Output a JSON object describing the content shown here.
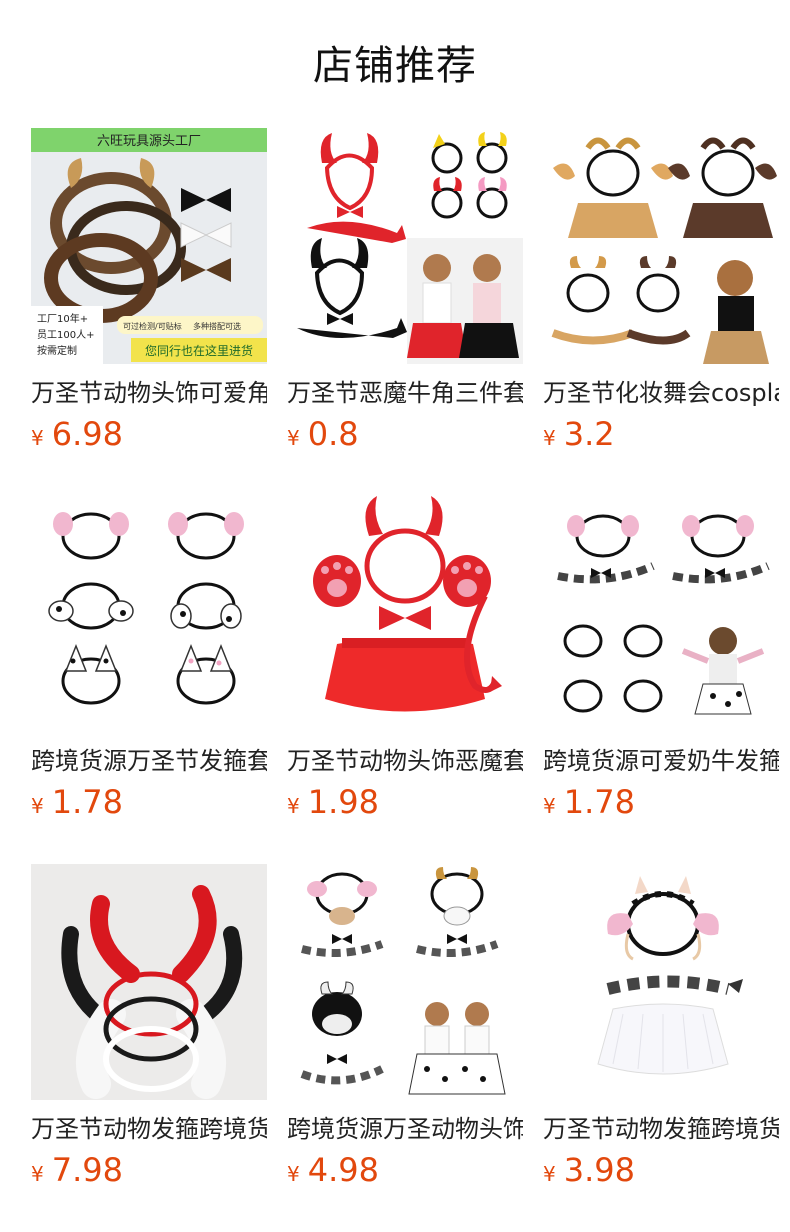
{
  "header": {
    "title": "店铺推荐"
  },
  "products": [
    {
      "name": "万圣节动物头饰可爱角",
      "currency": "¥",
      "price": "6.98",
      "thumb_text": {
        "banner": "六旺玩具源头工厂",
        "line1": "工厂10年+",
        "line2": "员工100人+",
        "line3": "按需定制",
        "tag1": "可过检测/可贴标",
        "tag2": "多种搭配可选",
        "slogan": "您同行也在这里进货"
      }
    },
    {
      "name": "万圣节恶魔牛角三件套",
      "currency": "¥",
      "price": "0.8"
    },
    {
      "name": "万圣节化妆舞会cosplay",
      "currency": "¥",
      "price": "3.2"
    },
    {
      "name": "跨境货源万圣节发箍套",
      "currency": "¥",
      "price": "1.78"
    },
    {
      "name": "万圣节动物头饰恶魔套",
      "currency": "¥",
      "price": "1.98"
    },
    {
      "name": "跨境货源可爱奶牛发箍",
      "currency": "¥",
      "price": "1.78"
    },
    {
      "name": "万圣节动物发箍跨境货",
      "currency": "¥",
      "price": "7.98"
    },
    {
      "name": "跨境货源万圣动物头饰",
      "currency": "¥",
      "price": "4.98"
    },
    {
      "name": "万圣节动物发箍跨境货源",
      "currency": "¥",
      "price": "3.98"
    }
  ],
  "colors": {
    "price": "#e2480d",
    "banner_green": "#7fd36c",
    "slogan_yellow": "#f2e34b",
    "devil_red": "#e0242b"
  }
}
